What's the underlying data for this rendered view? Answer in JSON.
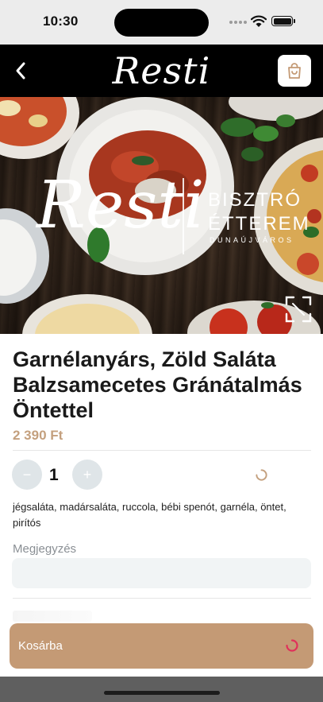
{
  "status_bar": {
    "time": "10:30"
  },
  "header": {
    "logo": "Resti"
  },
  "hero": {
    "logo": "Resti",
    "line1": "BISZTRÓ",
    "line2": "ÉTTEREM",
    "line3": "DUNAÚJVÁROS"
  },
  "product": {
    "title": "Garnélanyárs, Zöld Saláta Balzsamecetes Gránátalmás Öntettel",
    "price": "2 390 Ft",
    "quantity": "1",
    "minus_label": "−",
    "plus_label": "+",
    "ingredients": "jégsaláta, madársaláta, ruccola, bébi spenót, garnéla, öntet, pirítós"
  },
  "note": {
    "label": "Megjegyzés",
    "value": ""
  },
  "cart_button": {
    "label": "Kosárba"
  },
  "colors": {
    "accent": "#c49a75",
    "price": "#c4a07e",
    "spinner_red": "#e0305a",
    "header_bg": "#000000"
  },
  "icons": {
    "back": "chevron-left-icon",
    "cart": "shopping-bag-icon",
    "expand": "expand-icon",
    "loading": "spinner-icon"
  }
}
